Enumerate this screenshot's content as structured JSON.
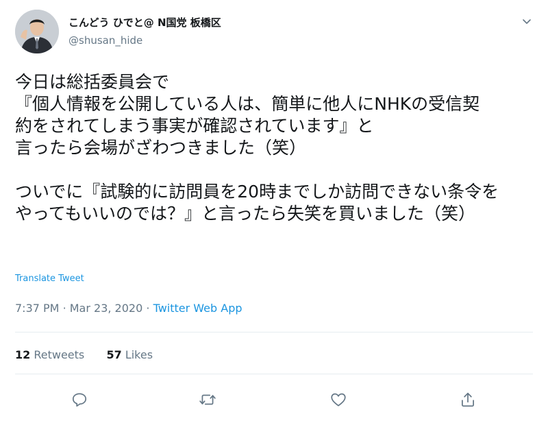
{
  "user": {
    "display_name": "こんどう ひでと@ N国党 板橋区",
    "handle": "@shusan_hide"
  },
  "tweet": {
    "lines": [
      "今日は総括委員会で",
      "『個人情報を公開している人は、簡単に他人にNHKの受信契",
      "約をされてしまう事実が確認されています』と",
      "言ったら会場がざわつきました（笑）",
      "",
      "ついでに『試験的に訪問員を20時までしか訪問できない条令を",
      "やってもいいのでは？』と言ったら失笑を買いました（笑）"
    ],
    "translate_label": "Translate Tweet",
    "time": "7:37 PM",
    "separator": "·",
    "date": "Mar 23, 2020",
    "app": "Twitter Web App"
  },
  "stats": {
    "retweets_count": "12",
    "retweets_label": "Retweets",
    "likes_count": "57",
    "likes_label": "Likes"
  },
  "icons": {
    "more": "chevron-down-icon",
    "reply": "reply-icon",
    "retweet": "retweet-icon",
    "like": "heart-icon",
    "share": "share-icon"
  },
  "colors": {
    "link": "#1b95e0",
    "secondary_text": "#657786",
    "primary_text": "#14171a",
    "divider": "#e6ecf0"
  }
}
